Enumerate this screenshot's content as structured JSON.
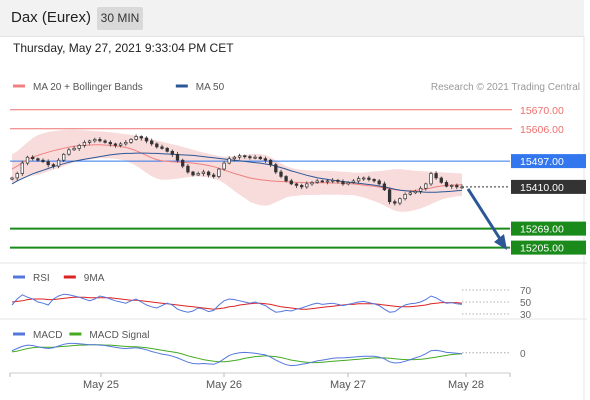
{
  "header": {
    "title": "Dax (Eurex)",
    "interval": "30 MIN",
    "timestamp": "Thursday, May 27, 2021 9:33:04 PM CET"
  },
  "colors": {
    "candle_up": "#2a2a2a",
    "candle_down": "#333333",
    "bollinger_band": "#f7d5d5",
    "ma20": "#f08080",
    "ma50": "#2b5797",
    "resistance": "#f07070",
    "pivot": "#3377ee",
    "support": "#1a8a1a",
    "current": "#333333",
    "arrow": "#2b5797",
    "rsi": "#5577dd",
    "rsi_ma": "#dd2222",
    "macd": "#5577dd",
    "macd_signal": "#44aa22"
  },
  "chart_data": [
    {
      "type": "line",
      "legend": [
        {
          "name": "MA 20 + Bollinger Bands",
          "color": "#f08080"
        },
        {
          "name": "MA 50",
          "color": "#2b5797"
        }
      ],
      "copyright": "Research © 2021 Trading Central",
      "ylim": [
        15180,
        15720
      ],
      "x_tick_labels": [
        "May 25",
        "May 26",
        "May 27",
        "May 28"
      ],
      "levels": [
        {
          "label": "15670.00",
          "value": 15670,
          "kind": "resistance"
        },
        {
          "label": "15606.00",
          "value": 15606,
          "kind": "resistance"
        },
        {
          "label": "15497.00",
          "value": 15497,
          "kind": "pivot"
        },
        {
          "label": "15410.00",
          "value": 15410,
          "kind": "current"
        },
        {
          "label": "15269.00",
          "value": 15269,
          "kind": "support"
        },
        {
          "label": "15205.00",
          "value": 15205,
          "kind": "support"
        }
      ],
      "series": [
        {
          "name": "price",
          "values": [
            15440,
            15455,
            15490,
            15510,
            15505,
            15500,
            15495,
            15485,
            15480,
            15500,
            15520,
            15535,
            15540,
            15550,
            15560,
            15565,
            15570,
            15565,
            15560,
            15555,
            15550,
            15555,
            15560,
            15570,
            15580,
            15575,
            15565,
            15555,
            15545,
            15540,
            15530,
            15520,
            15500,
            15480,
            15460,
            15450,
            15455,
            15460,
            15450,
            15445,
            15470,
            15490,
            15505,
            15510,
            15515,
            15512,
            15508,
            15510,
            15505,
            15500,
            15485,
            15460,
            15445,
            15430,
            15420,
            15415,
            15410,
            15420,
            15425,
            15430,
            15428,
            15430,
            15432,
            15428,
            15420,
            15425,
            15430,
            15438,
            15440,
            15435,
            15430,
            15420,
            15400,
            15360,
            15355,
            15370,
            15385,
            15390,
            15395,
            15405,
            15420,
            15455,
            15440,
            15425,
            15412,
            15415,
            15410,
            15410
          ]
        },
        {
          "name": "MA 20",
          "values": [
            15470,
            15480,
            15492,
            15502,
            15510,
            15516,
            15522,
            15527,
            15532,
            15536,
            15540,
            15544,
            15547,
            15549,
            15550,
            15551,
            15552,
            15552,
            15551,
            15550,
            15548,
            15546,
            15543,
            15538,
            15532,
            15524,
            15516,
            15508,
            15502,
            15498,
            15496,
            15495,
            15494,
            15493,
            15492,
            15490,
            15488,
            15485,
            15482,
            15478,
            15473,
            15467,
            15461,
            15455,
            15450,
            15445,
            15440,
            15437,
            15434,
            15432,
            15430,
            15429,
            15428,
            15427,
            15426,
            15425,
            15425,
            15424,
            15424,
            15424,
            15424,
            15424,
            15423,
            15423,
            15422,
            15421,
            15420,
            15418,
            15416,
            15414,
            15412,
            15409,
            15406,
            15403,
            15400,
            15398,
            15397,
            15397,
            15398,
            15400,
            15403,
            15406,
            15410,
            15413,
            15415,
            15416,
            15417,
            15417
          ]
        },
        {
          "name": "BB upper",
          "values": [
            15520,
            15530,
            15545,
            15560,
            15575,
            15585,
            15590,
            15595,
            15598,
            15600,
            15602,
            15603,
            15603,
            15602,
            15601,
            15600,
            15598,
            15597,
            15596,
            15594,
            15592,
            15590,
            15588,
            15586,
            15583,
            15579,
            15575,
            15570,
            15566,
            15562,
            15558,
            15554,
            15550,
            15545,
            15540,
            15535,
            15530,
            15526,
            15522,
            15518,
            15514,
            15512,
            15512,
            15514,
            15516,
            15518,
            15520,
            15521,
            15520,
            15518,
            15510,
            15500,
            15490,
            15480,
            15474,
            15470,
            15468,
            15466,
            15465,
            15465,
            15464,
            15464,
            15463,
            15462,
            15461,
            15460,
            15458,
            15458,
            15458,
            15460,
            15462,
            15463,
            15465,
            15468,
            15470,
            15470,
            15468,
            15466,
            15464,
            15463,
            15462,
            15461,
            15460,
            15459,
            15458,
            15457,
            15456,
            15455
          ]
        },
        {
          "name": "BB lower",
          "values": [
            15420,
            15430,
            15440,
            15445,
            15448,
            15450,
            15456,
            15462,
            15468,
            15474,
            15480,
            15486,
            15492,
            15498,
            15500,
            15502,
            15505,
            15507,
            15506,
            15506,
            15505,
            15502,
            15498,
            15490,
            15481,
            15470,
            15457,
            15446,
            15438,
            15434,
            15434,
            15436,
            15438,
            15440,
            15443,
            15445,
            15446,
            15444,
            15442,
            15438,
            15432,
            15422,
            15410,
            15396,
            15384,
            15372,
            15360,
            15353,
            15348,
            15346,
            15350,
            15358,
            15366,
            15374,
            15378,
            15380,
            15382,
            15382,
            15383,
            15383,
            15384,
            15384,
            15383,
            15384,
            15383,
            15382,
            15382,
            15378,
            15374,
            15368,
            15362,
            15355,
            15347,
            15338,
            15330,
            15326,
            15326,
            15328,
            15332,
            15337,
            15344,
            15351,
            15360,
            15367,
            15372,
            15375,
            15378,
            15379
          ]
        },
        {
          "name": "MA 50",
          "values": [
            15420,
            15430,
            15438,
            15446,
            15454,
            15460,
            15466,
            15472,
            15478,
            15483,
            15488,
            15493,
            15497,
            15500,
            15503,
            15506,
            15509,
            15512,
            15515,
            15518,
            15520,
            15522,
            15523,
            15523,
            15524,
            15524,
            15524,
            15523,
            15523,
            15522,
            15521,
            15520,
            15519,
            15518,
            15517,
            15516,
            15514,
            15512,
            15510,
            15508,
            15506,
            15504,
            15502,
            15500,
            15498,
            15496,
            15494,
            15492,
            15490,
            15487,
            15484,
            15480,
            15475,
            15470,
            15464,
            15459,
            15454,
            15449,
            15445,
            15441,
            15438,
            15435,
            15432,
            15430,
            15428,
            15426,
            15424,
            15422,
            15420,
            15418,
            15416,
            15413,
            15410,
            15406,
            15402,
            15399,
            15397,
            15395,
            15394,
            15393,
            15392,
            15392,
            15392,
            15393,
            15394,
            15395,
            15397,
            15398
          ]
        }
      ]
    },
    {
      "type": "line",
      "legend": [
        {
          "name": "RSI",
          "color": "#5577dd"
        },
        {
          "name": "9MA",
          "color": "#dd2222"
        }
      ],
      "ylim": [
        25,
        75
      ],
      "y_tick_labels": [
        "70",
        "50",
        "30"
      ],
      "series": [
        {
          "name": "RSI",
          "values": [
            45,
            55,
            62,
            58,
            55,
            50,
            48,
            45,
            55,
            60,
            63,
            62,
            60,
            58,
            55,
            52,
            55,
            60,
            58,
            55,
            52,
            50,
            48,
            52,
            55,
            50,
            45,
            42,
            40,
            44,
            48,
            45,
            38,
            35,
            33,
            35,
            40,
            38,
            34,
            36,
            45,
            52,
            55,
            54,
            52,
            50,
            48,
            50,
            47,
            44,
            38,
            33,
            34,
            36,
            35,
            38,
            40,
            43,
            46,
            48,
            46,
            47,
            48,
            46,
            44,
            46,
            48,
            50,
            51,
            49,
            47,
            44,
            38,
            33,
            34,
            40,
            45,
            47,
            48,
            50,
            54,
            60,
            57,
            52,
            48,
            49,
            47,
            46
          ]
        },
        {
          "name": "9MA",
          "values": [
            50,
            51,
            52,
            54,
            55,
            55,
            55,
            54,
            54,
            55,
            56,
            57,
            58,
            58,
            58,
            57,
            57,
            57,
            57,
            57,
            56,
            55,
            54,
            53,
            53,
            52,
            51,
            50,
            49,
            48,
            47,
            46,
            45,
            44,
            43,
            42,
            41,
            40,
            39,
            38,
            39,
            40,
            42,
            43,
            45,
            46,
            47,
            48,
            48,
            47,
            46,
            44,
            42,
            41,
            40,
            39,
            38,
            38,
            39,
            40,
            41,
            42,
            43,
            44,
            45,
            46,
            46,
            47,
            47,
            47,
            47,
            46,
            45,
            44,
            43,
            42,
            42,
            42,
            43,
            44,
            45,
            47,
            48,
            49,
            49,
            49,
            49,
            48
          ]
        }
      ]
    },
    {
      "type": "line",
      "legend": [
        {
          "name": "MACD",
          "color": "#5577dd"
        },
        {
          "name": "MACD Signal",
          "color": "#44aa22"
        }
      ],
      "ylim": [
        -45,
        30
      ],
      "y_tick_labels": [
        "0"
      ],
      "series": [
        {
          "name": "MACD",
          "values": [
            5,
            10,
            15,
            18,
            17,
            14,
            12,
            10,
            12,
            16,
            20,
            22,
            22,
            21,
            20,
            19,
            19,
            18,
            17,
            15,
            13,
            11,
            10,
            11,
            12,
            10,
            7,
            3,
            0,
            -3,
            -5,
            -8,
            -12,
            -17,
            -22,
            -25,
            -26,
            -25,
            -26,
            -27,
            -22,
            -14,
            -6,
            -2,
            0,
            1,
            0,
            -1,
            -3,
            -5,
            -10,
            -17,
            -23,
            -28,
            -30,
            -29,
            -27,
            -25,
            -22,
            -19,
            -17,
            -15,
            -13,
            -12,
            -12,
            -11,
            -10,
            -9,
            -8,
            -8,
            -8,
            -10,
            -14,
            -21,
            -24,
            -23,
            -20,
            -16,
            -12,
            -8,
            -2,
            5,
            6,
            4,
            1,
            0,
            -1,
            -2
          ]
        },
        {
          "name": "MACD Signal",
          "values": [
            2,
            4,
            7,
            10,
            12,
            13,
            13,
            13,
            13,
            14,
            15,
            16,
            17,
            18,
            18,
            19,
            19,
            19,
            18,
            18,
            17,
            16,
            15,
            14,
            14,
            13,
            12,
            10,
            8,
            6,
            4,
            2,
            0,
            -3,
            -7,
            -10,
            -13,
            -16,
            -18,
            -20,
            -21,
            -21,
            -20,
            -18,
            -16,
            -13,
            -11,
            -9,
            -8,
            -7,
            -8,
            -9,
            -11,
            -14,
            -17,
            -19,
            -21,
            -22,
            -23,
            -23,
            -22,
            -21,
            -20,
            -19,
            -18,
            -17,
            -16,
            -15,
            -14,
            -13,
            -12,
            -12,
            -12,
            -13,
            -14,
            -15,
            -16,
            -16,
            -16,
            -15,
            -14,
            -12,
            -10,
            -8,
            -6,
            -4,
            -3,
            -2
          ]
        }
      ]
    }
  ]
}
